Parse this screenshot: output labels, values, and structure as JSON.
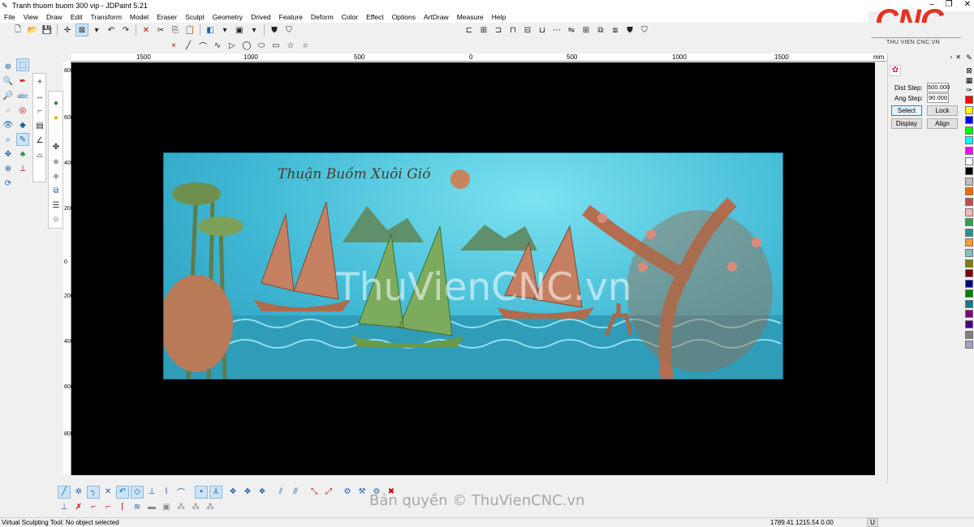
{
  "window": {
    "title": "Tranh thuom buom 300 vip - JDPaint 5.21",
    "controls": [
      "–",
      "❐",
      "✕"
    ]
  },
  "menu": [
    "File",
    "View",
    "Draw",
    "Edit",
    "Transform",
    "Model",
    "Eraser",
    "Sculpt",
    "Geometry",
    "Drived",
    "Feature",
    "Deform",
    "Color",
    "Effect",
    "Options",
    "ArtDraw",
    "Measure",
    "Help"
  ],
  "logo": {
    "text": "CNC",
    "tagline": "THU VIEN CNC.VN"
  },
  "ruler_top": [
    "1500",
    "1000",
    "500",
    "0",
    "500",
    "1000",
    "1500",
    "mm"
  ],
  "ruler_left": [
    "800",
    "600",
    "400",
    "200",
    "0",
    "200",
    "400",
    "600",
    "800"
  ],
  "canvas": {
    "calligraphy": "Thuận Buồm Xuôi Gió",
    "watermark": "ThuVienCNC.vn"
  },
  "right_panel": {
    "dist_step_label": "Dist Step:",
    "dist_step_value": "500.000",
    "ang_step_label": "Ang Step:",
    "ang_step_value": "90.000",
    "buttons": [
      "Select",
      "Lock",
      "Display",
      "Align"
    ]
  },
  "palette": [
    "#ff0000",
    "#ffff00",
    "#0000ff",
    "#00ff00",
    "#00ffff",
    "#ff00ff",
    "#ffffff",
    "#000000",
    "#c0c0c0",
    "#ff6a00",
    "#c0504d",
    "#ffb6b6",
    "#2ea44f",
    "#2f8f8f",
    "#ff9933",
    "#80c0c0",
    "#808000",
    "#800000",
    "#000080",
    "#008000",
    "#008080",
    "#800080",
    "#4b0082",
    "#7f7f7f",
    "#a0a0c0"
  ],
  "copyright": "Bản quyền © ThuVienCNC.vn",
  "status": {
    "message": "Virtual Sculpting Tool: No object selected",
    "coords": "1789.41 1215.54 0.00",
    "unit": "U"
  }
}
